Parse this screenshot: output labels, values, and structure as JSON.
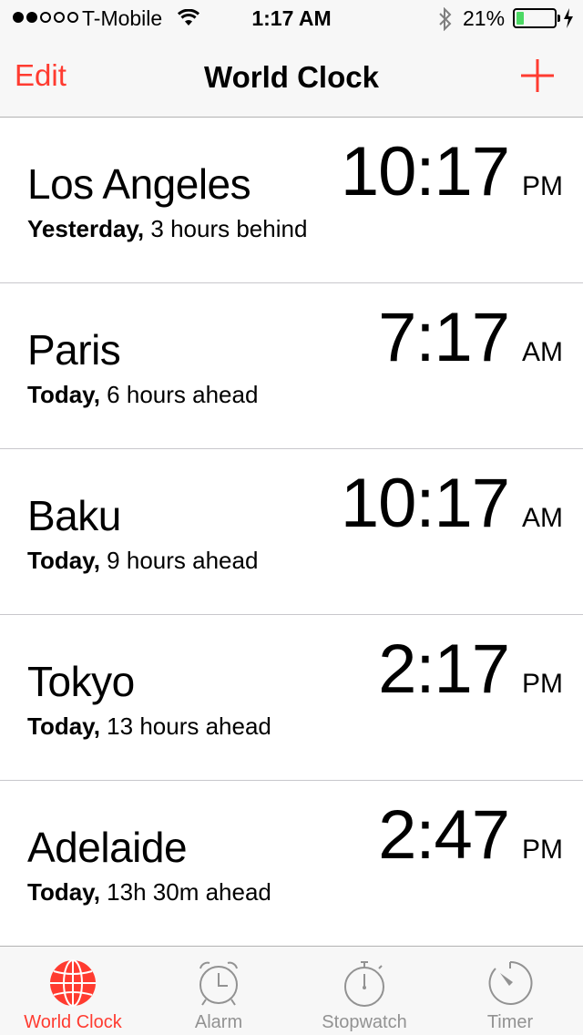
{
  "status": {
    "carrier": "T-Mobile",
    "time": "1:17 AM",
    "battery_pct": "21%",
    "battery_level": 0.21,
    "signal_bars": 2
  },
  "nav": {
    "edit_label": "Edit",
    "title": "World Clock",
    "add_icon": "plus-icon"
  },
  "clocks": [
    {
      "city": "Los Angeles",
      "day": "Yesterday,",
      "offset": "3 hours behind",
      "time": "10:17",
      "ampm": "PM"
    },
    {
      "city": "Paris",
      "day": "Today,",
      "offset": "6 hours ahead",
      "time": "7:17",
      "ampm": "AM"
    },
    {
      "city": "Baku",
      "day": "Today,",
      "offset": "9 hours ahead",
      "time": "10:17",
      "ampm": "AM"
    },
    {
      "city": "Tokyo",
      "day": "Today,",
      "offset": "13 hours ahead",
      "time": "2:17",
      "ampm": "PM"
    },
    {
      "city": "Adelaide",
      "day": "Today,",
      "offset": "13h 30m ahead",
      "time": "2:47",
      "ampm": "PM"
    }
  ],
  "tabs": [
    {
      "label": "World Clock",
      "icon": "globe-icon",
      "active": true
    },
    {
      "label": "Alarm",
      "icon": "alarm-clock-icon",
      "active": false
    },
    {
      "label": "Stopwatch",
      "icon": "stopwatch-icon",
      "active": false
    },
    {
      "label": "Timer",
      "icon": "timer-icon",
      "active": false
    }
  ],
  "colors": {
    "accent": "#ff3b30",
    "inactive_tab": "#929292",
    "battery": "#4cd964"
  }
}
